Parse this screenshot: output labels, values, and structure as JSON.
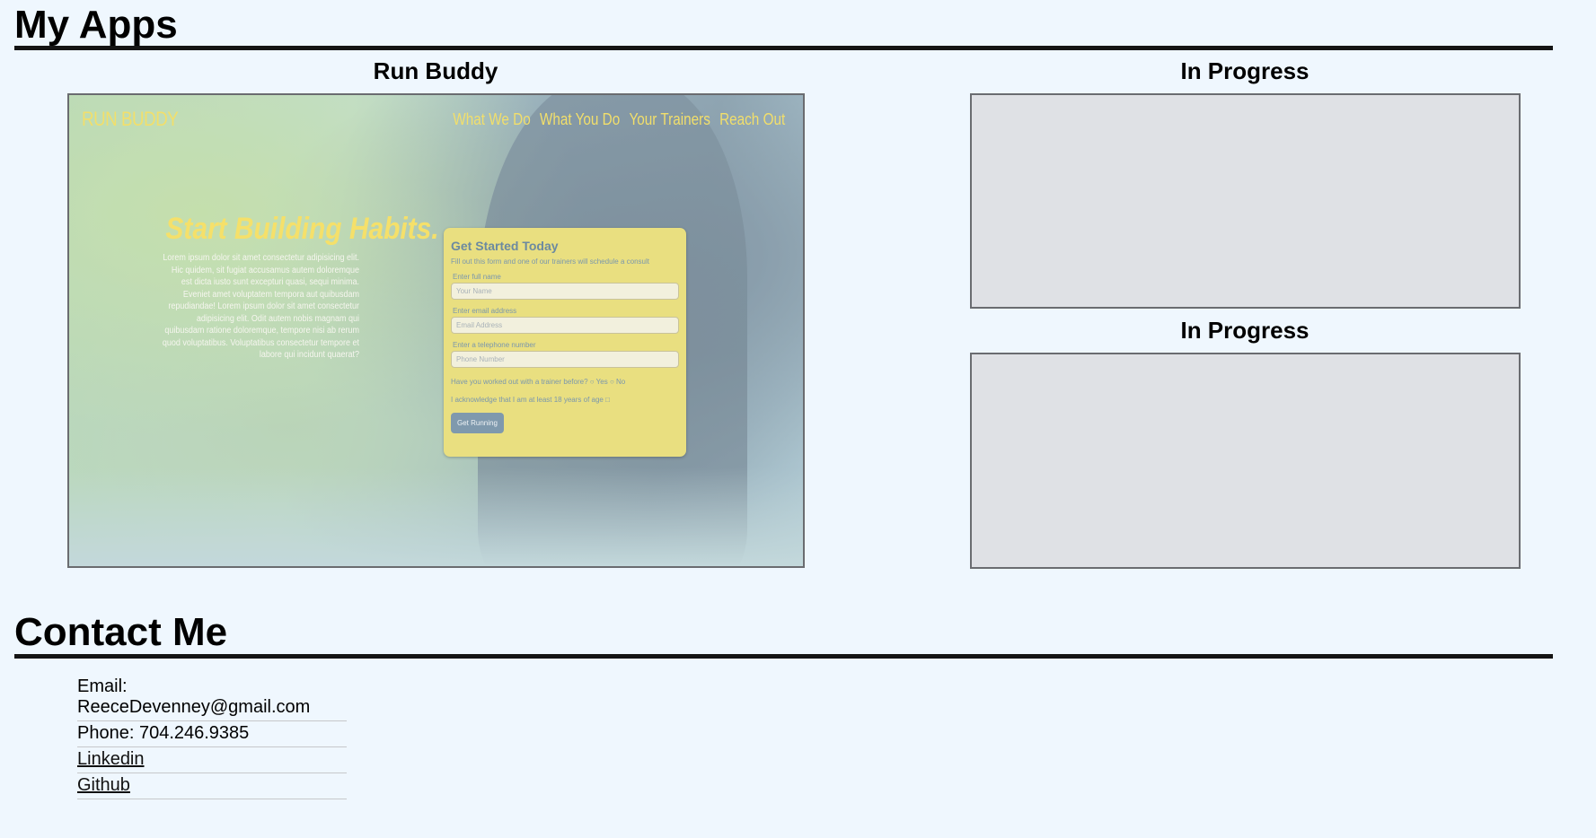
{
  "apps": {
    "heading": "My Apps",
    "cards": [
      {
        "title": "Run Buddy",
        "preview": {
          "logo": "RUN BUDDY",
          "nav": [
            "What We Do",
            "What You Do",
            "Your Trainers",
            "Reach Out"
          ],
          "hero_title": "Start Building Habits.",
          "hero_body": "Lorem ipsum dolor sit amet consectetur adipisicing elit. Hic quidem, sit fugiat accusamus autem doloremque est dicta iusto sunt excepturi quasi, sequi minima. Eveniet amet voluptatem tempora aut quibusdam repudiandae! Lorem ipsum dolor sit amet consectetur adipisicing elit. Odit autem nobis magnam qui quibusdam ratione doloremque, tempore nisi ab rerum quod voluptatibus. Voluptatibus consectetur tempore et labore qui incidunt quaerat?",
          "form": {
            "title": "Get Started Today",
            "subtitle": "Fill out this form and one of our trainers will schedule a consult",
            "name_label": "Enter full name",
            "name_placeholder": "Your Name",
            "email_label": "Enter email address",
            "email_placeholder": "Email Address",
            "phone_label": "Enter a telephone number",
            "phone_placeholder": "Phone Number",
            "trainer_question": "Have you worked out with a trainer before?",
            "yes": "Yes",
            "no": "No",
            "age_ack": "I acknowledge that I am at least 18 years of age",
            "submit": "Get Running"
          }
        }
      },
      {
        "title": "In Progress"
      },
      {
        "title": "In Progress"
      }
    ]
  },
  "contact": {
    "heading": "Contact Me",
    "email_label": "Email:",
    "email": "ReeceDevenney@gmail.com",
    "phone": "Phone: 704.246.9385",
    "linkedin": "Linkedin",
    "github": "Github"
  },
  "colors": {
    "background": "#eff7fe",
    "rule": "#141414",
    "placeholder": "#dfe1e5",
    "runbuddy_accent": "#f2df6b"
  }
}
